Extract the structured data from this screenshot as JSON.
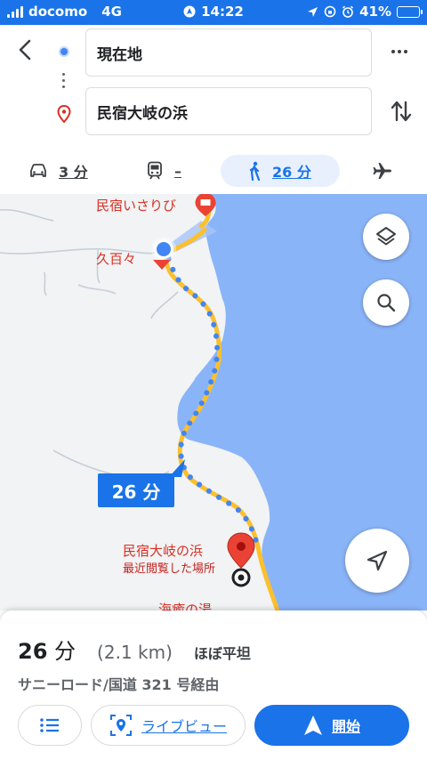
{
  "status_bar": {
    "carrier": "docomo",
    "network": "4G",
    "time": "14:22",
    "battery": "41%",
    "battery_level": 0.41
  },
  "header": {
    "origin": "現在地",
    "destination": "民宿大岐の浜"
  },
  "travel_modes": {
    "car": "3 分",
    "transit": "–",
    "walk": "26 分",
    "selected": "walk"
  },
  "map": {
    "labels": {
      "inn_isaribi": "民宿いさりび",
      "kumomo": "久百々",
      "dest_name": "民宿大岐の浜",
      "dest_sub": "最近閲覧した場所",
      "onsen": "海癒の湯"
    },
    "eta_bubble": "26 分",
    "colors": {
      "water": "#8ab4f8",
      "land": "#f1f3f4",
      "route": "#4285f4",
      "road": "#fbc02d",
      "pin": "#ea4335"
    }
  },
  "summary": {
    "duration_num": "26",
    "duration_unit": "分",
    "distance": "(2.1 km)",
    "terrain": "ほぼ平坦",
    "via": "サニーロード/国道 321 号経由"
  },
  "buttons": {
    "live_view": "ライブビュー",
    "start": "開始"
  }
}
